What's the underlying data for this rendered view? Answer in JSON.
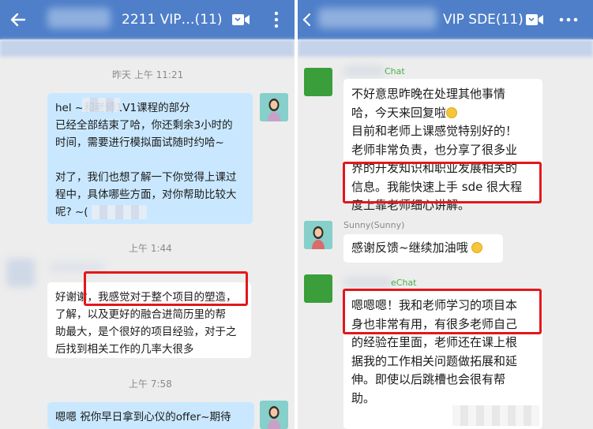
{
  "left": {
    "title": "2211 VIP…(11)",
    "time1": "昨天 上午 11:21",
    "msg1": "hel          ~和老师1V1课程的部分\n已经全部结束了哈，你还剩余3小时的\n时间，需要进行模拟面试随时约哈~\n\n对了，我们也想了解一下你觉得上课过\n程中，具体哪些方面，对你帮助比较大\n呢? ~(",
    "time2": "上午 1:44",
    "msg2": "好谢谢，我感觉对于整个项目的塑造，\n了解，以及更好的融合进简历里的帮\n助最大，是个很好的项目经验，对于之\n后找到相关工作的几率大很多",
    "time3": "上午 7:58",
    "msg3": "嗯嗯 祝你早日拿到心仪的offer~期待"
  },
  "right": {
    "title": "VIP SDE(11)",
    "sender1": "Chat",
    "msg1": "不好意思昨晚在处理其他事情\n哈，今天来回复啦",
    "msg1b": "目前和老师上课感觉特别好的！\n老师非常负责，也分享了很多业\n界的开发知识和职业发展相关的\n信息。我能快速上手 sde 很大程\n度上靠老师细心讲解。",
    "sender2": "Sunny(Sunny)",
    "msg2": "感谢反馈~继续加油哦",
    "sender3": "eChat",
    "msg3": "嗯嗯嗯！我和老师学习的项目本\n身也非常有用，有很多老师自己\n的经验在里面，老师还在课上根\n据我的工作相关问题做拓展和延\n伸。即使以后跳槽也会很有帮\n助。\n\n非常非常感谢 @"
  },
  "colors": {
    "header": "#4f7fc9",
    "self_bubble": "#c9e8ff",
    "highlight": "#e3171b"
  }
}
